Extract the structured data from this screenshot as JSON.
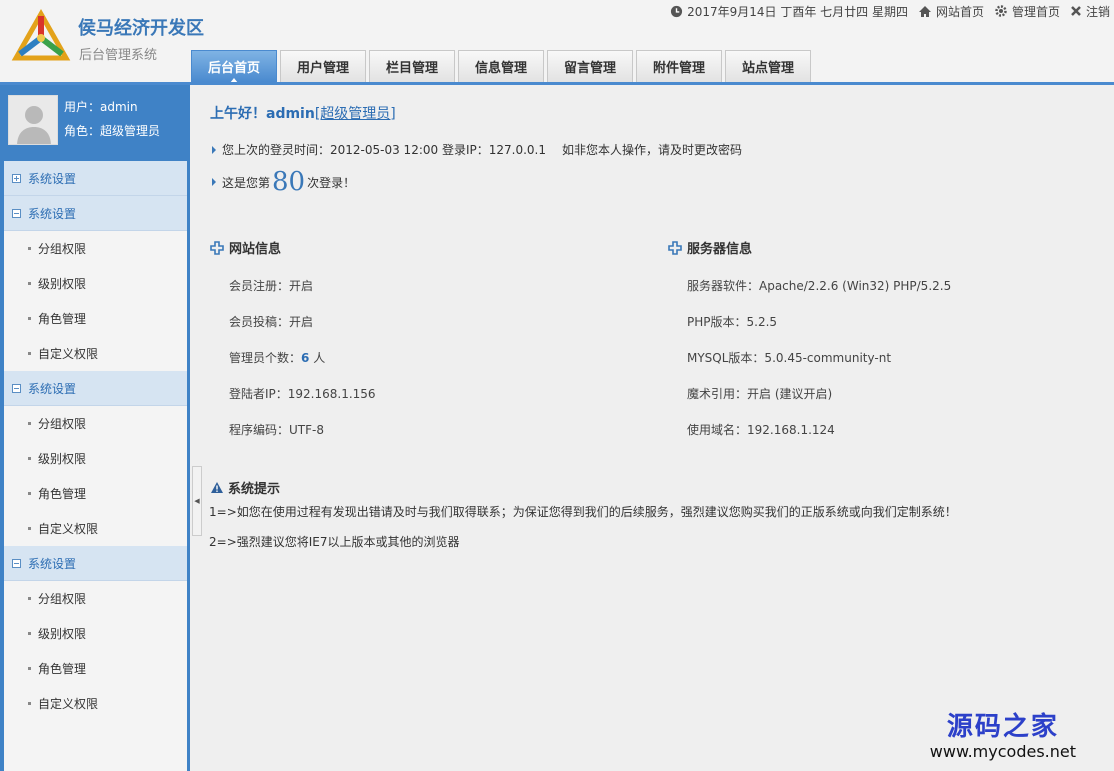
{
  "header": {
    "title": "侯马经济开发区",
    "subtitle": "后台管理系统",
    "date": "2017年9月14日 丁酉年 七月廿四 星期四",
    "links": [
      {
        "label": "网站首页",
        "icon": "home-icon"
      },
      {
        "label": "管理首页",
        "icon": "gear-icon"
      },
      {
        "label": "注销",
        "icon": "close-icon"
      }
    ]
  },
  "nav": {
    "tabs": [
      "后台首页",
      "用户管理",
      "栏目管理",
      "信息管理",
      "留言管理",
      "附件管理",
      "站点管理"
    ],
    "active_index": 0
  },
  "user": {
    "name_label": "用户：admin",
    "role_label": "角色：超级管理员"
  },
  "menu": [
    {
      "title": "系统设置",
      "expanded": false,
      "items": []
    },
    {
      "title": "系统设置",
      "expanded": true,
      "items": [
        "分组权限",
        "级别权限",
        "角色管理",
        "自定义权限"
      ]
    },
    {
      "title": "系统设置",
      "expanded": true,
      "items": [
        "分组权限",
        "级别权限",
        "角色管理",
        "自定义权限"
      ]
    },
    {
      "title": "系统设置",
      "expanded": true,
      "items": [
        "分组权限",
        "级别权限",
        "角色管理",
        "自定义权限"
      ]
    }
  ],
  "main": {
    "greeting": "上午好！admin",
    "greeting_role": "[超级管理员]",
    "last_login": "您上次的登灵时间：2012-05-03 12:00 登录IP：127.0.0.1",
    "last_login_warn": "如非您本人操作，请及时更改密码",
    "login_count_prefix": "这是您第",
    "login_count": "80",
    "login_count_suffix": "次登录！",
    "site_info": {
      "title": "网站信息",
      "rows": {
        "reg": "会员注册：开启",
        "post": "会员投稿：开启",
        "admin_prefix": "管理员个数：",
        "admin_count": "6",
        "admin_suffix": " 人",
        "ip": "登陆者IP：192.168.1.156",
        "encoding": "程序编码：UTF-8"
      }
    },
    "server_info": {
      "title": "服务器信息",
      "rows": [
        "服务器软件：Apache/2.2.6 (Win32) PHP/5.2.5",
        "PHP版本：5.2.5",
        "MYSQL版本：5.0.45-community-nt",
        "魔术引用：开启 (建议开启)",
        "使用域名：192.168.1.124"
      ]
    },
    "tips": {
      "title": "系统提示",
      "lines": [
        "1=>如您在使用过程有发现出错请及时与我们取得联系；为保证您得到我们的后续服务，强烈建议您购买我们的正版系统或向我们定制系统！",
        "2=>强烈建议您将IE7以上版本或其他的浏览器"
      ]
    }
  },
  "watermark": {
    "cn": "源码之家",
    "url": "www.mycodes.net"
  },
  "colors": {
    "accent": "#3f82c6",
    "link": "#2c6db3",
    "watermark": "#2c40c9"
  }
}
